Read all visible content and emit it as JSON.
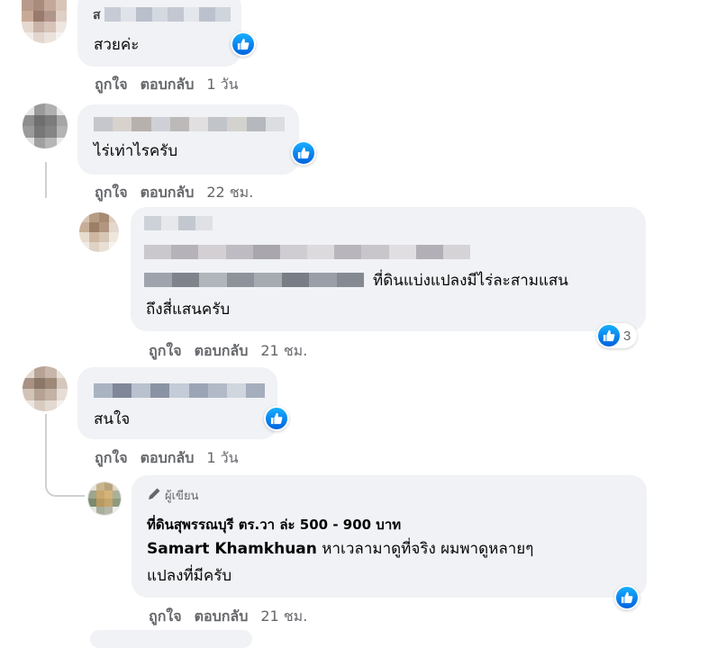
{
  "colors": {
    "like_blue": "#1877f2",
    "bubble_bg": "#f0f2f5",
    "meta_text": "#65676b"
  },
  "comments": [
    {
      "name_prefix": "ส",
      "text": "สวยค่ะ",
      "like_label": "ถูกใจ",
      "reply_label": "ตอบกลับ",
      "time": "1 วัน"
    },
    {
      "text": "ไร่เท่าไรครับ",
      "like_label": "ถูกใจ",
      "reply_label": "ตอบกลับ",
      "time": "22 ชม."
    },
    {
      "text_line1": "ที่ดินแบ่งแปลงมีไร่ละสามแสน",
      "text_line2": "ถึงสี่แสนครับ",
      "like_label": "ถูกใจ",
      "reply_label": "ตอบกลับ",
      "time": "21 ชม.",
      "reaction_count": "3"
    },
    {
      "text": "สนใจ",
      "like_label": "ถูกใจ",
      "reply_label": "ตอบกลับ",
      "time": "1 วัน"
    },
    {
      "badge": "ผู้เขียน",
      "author": "ที่ดินสุพรรณบุรี ตร.วา ล่ะ 500 - 900 บาท",
      "mention": "Samart Khamkhuan",
      "text_line1": "หาเวลามาดูที่จริง ผมพาดูหลายๆ",
      "text_line2": "แปลงที่มีครับ",
      "like_label": "ถูกใจ",
      "reply_label": "ตอบกลับ",
      "time": "21 ชม."
    }
  ],
  "icons": {
    "like": "thumbs-up-icon",
    "badge": "pencil-icon"
  }
}
